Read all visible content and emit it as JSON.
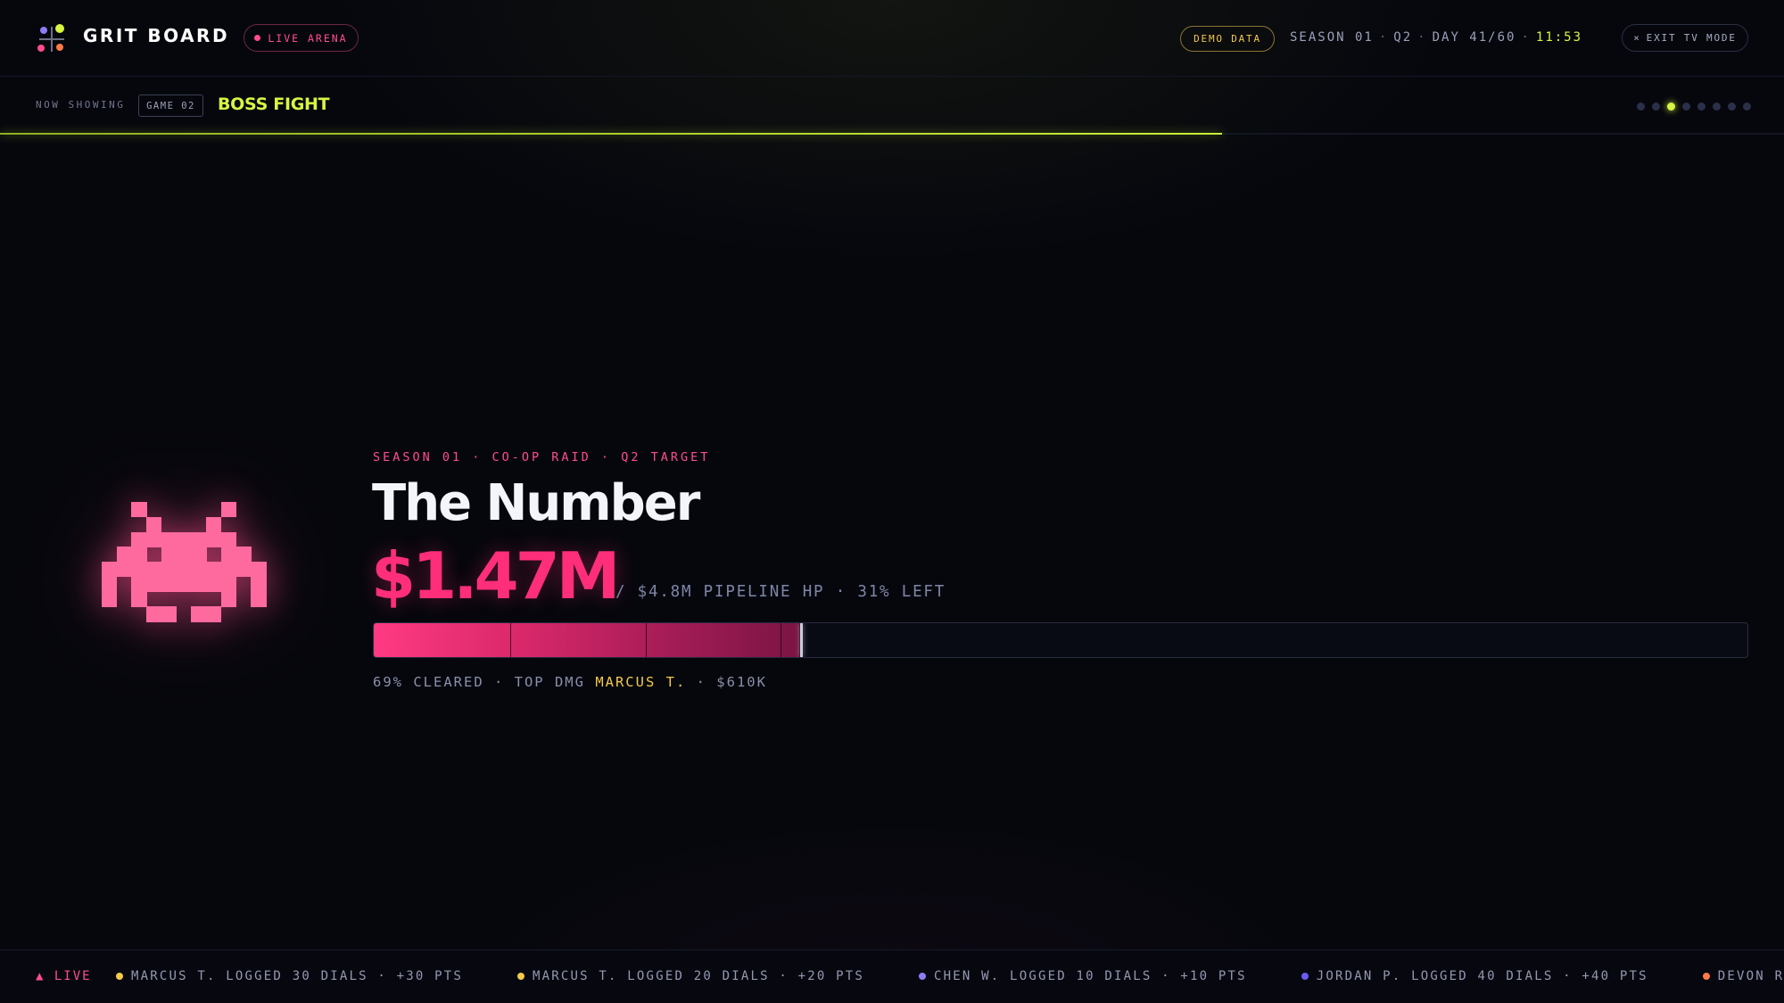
{
  "header": {
    "brand": "GRIT BOARD",
    "live_label": "LIVE ARENA",
    "demo_label": "DEMO DATA",
    "season": "SEASON 01",
    "quarter": "Q2",
    "day": "DAY 41/60",
    "clock": "11:53",
    "exit_label": "EXIT TV MODE",
    "exit_icon": "×"
  },
  "now_showing": {
    "label": "NOW SHOWING",
    "game_chip": "GAME 02",
    "game_title": "BOSS FIGHT",
    "rotation_progress": 0.685,
    "slides_total": 8,
    "slide_active_index": 2
  },
  "boss": {
    "eyebrow": "SEASON 01 · CO-OP RAID · Q2 TARGET",
    "name": "The Number",
    "value": "$1.47M",
    "sub": "/ $4.8M PIPELINE HP · 31% LEFT",
    "cleared_fraction": 0.31,
    "footer_prefix": "69% CLEARED · TOP DMG ",
    "top_player": "MARCUS T.",
    "footer_suffix": " · $610K",
    "colors": {
      "accent": "#ff2e7a",
      "gold": "#f2c94c",
      "lime": "#d8f542"
    }
  },
  "ticker": {
    "live_label": "▲ LIVE",
    "items": [
      {
        "text": "MARCUS T. LOGGED 30 DIALS · +30 PTS",
        "color": "#f2c94c"
      },
      {
        "text": "MARCUS T. LOGGED 20 DIALS · +20 PTS",
        "color": "#f2c94c"
      },
      {
        "text": "CHEN W. LOGGED 10 DIALS · +10 PTS",
        "color": "#8b7cf6"
      },
      {
        "text": "JORDAN P. LOGGED 40 DIALS · +40 PTS",
        "color": "#6a5cf0"
      },
      {
        "text": "DEVON R. HAD A LIVE",
        "color": "#ff7a45"
      }
    ]
  }
}
